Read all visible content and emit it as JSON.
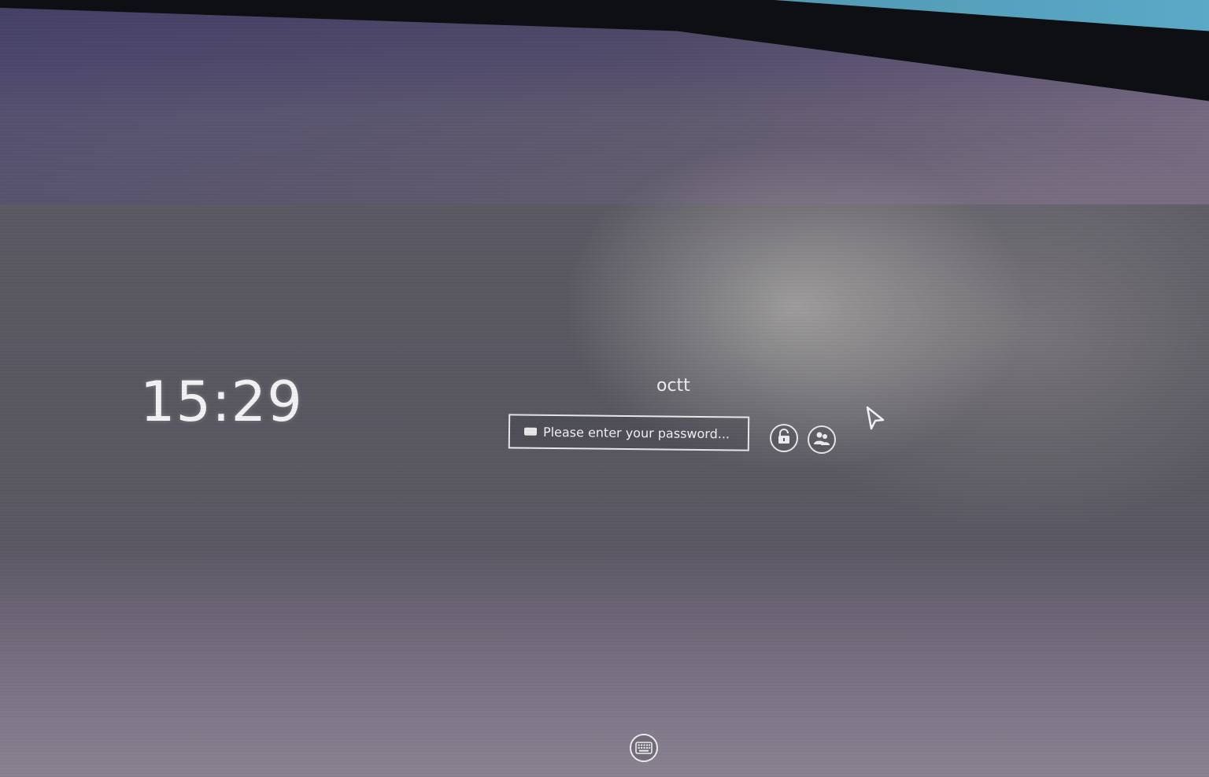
{
  "lock_screen": {
    "clock": "15:29",
    "username": "octt",
    "password_placeholder": "Please enter your password...",
    "buttons": {
      "unlock_icon": "lock-icon",
      "switch_user_icon": "users-icon",
      "onscreen_keyboard_icon": "keyboard-icon"
    }
  },
  "colors": {
    "text": "#f0f0f2",
    "background": "#5a5962"
  }
}
